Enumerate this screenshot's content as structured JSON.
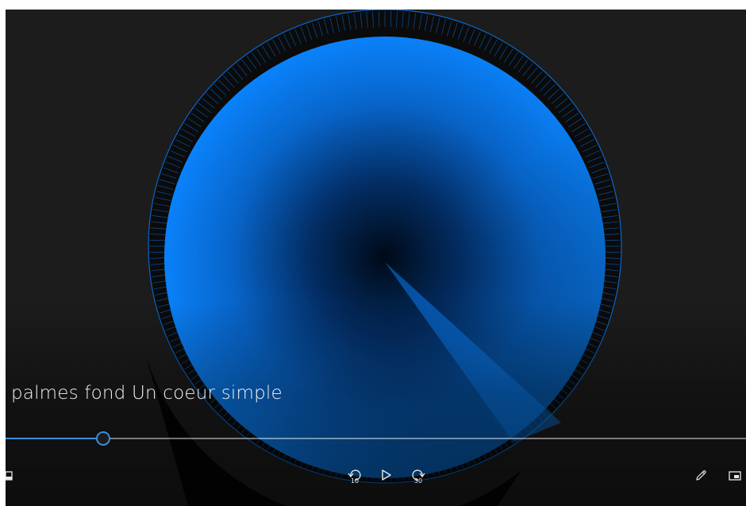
{
  "media": {
    "title": "palmes fond Un coeur simple"
  },
  "player": {
    "progress": 0.131,
    "skip_back_seconds": "10",
    "skip_forward_seconds": "30"
  },
  "colors": {
    "background": "#1c1c1c",
    "accent": "#3a8fde",
    "artwork_blue": "#0a84ff"
  },
  "icons": {
    "left": "window-icon",
    "skip_back": "skip-back-10-icon",
    "play": "play-icon",
    "skip_forward": "skip-forward-30-icon",
    "edit": "pencil-icon",
    "mini": "mini-view-icon"
  }
}
